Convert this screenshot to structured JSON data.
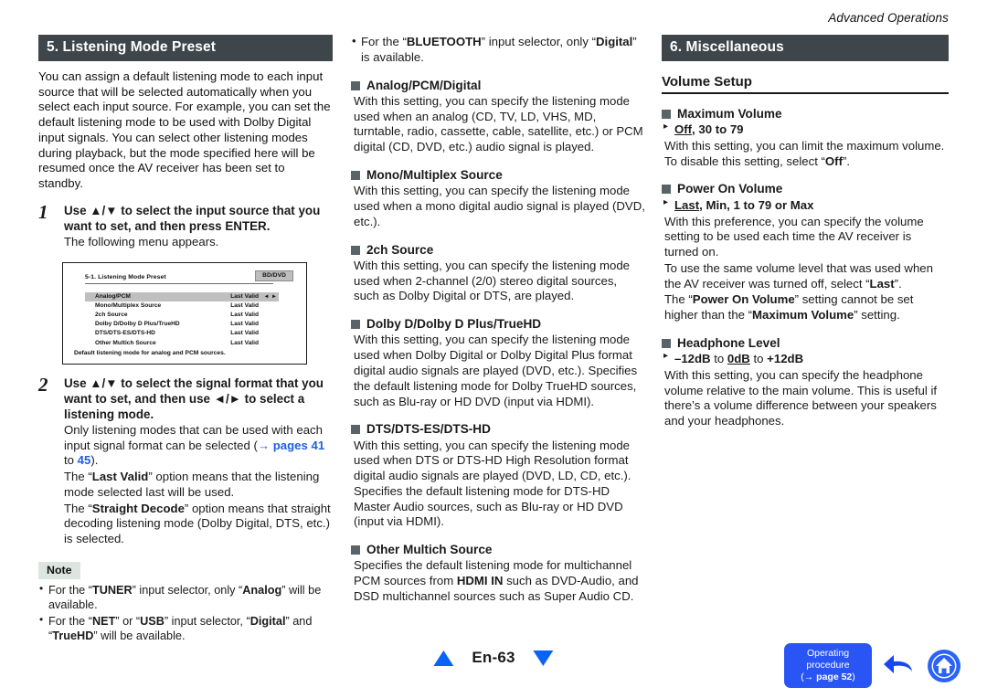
{
  "running_head": "Advanced Operations",
  "col1": {
    "section_title": "5. Listening Mode Preset",
    "intro": "You can assign a default listening mode to each input source that will be selected automatically when you select each input source. For example, you can set the default listening mode to be used with Dolby Digital input signals. You can select other listening modes during playback, but the mode specified here will be resumed once the AV receiver has been set to standby.",
    "step1": {
      "num": "1",
      "head_a": "Use ",
      "head_arrows": "▲/▼",
      "head_b": " to select the input source that you want to set, and then press ENTER.",
      "body": "The following menu appears."
    },
    "osd": {
      "title": "5-1. Listening Mode Preset",
      "badge": "BD/DVD",
      "rows": [
        {
          "label": "Analog/PCM",
          "value": "Last Valid",
          "selected": true,
          "arrows": "◂ ▸"
        },
        {
          "label": "Mono/Multiplex Source",
          "value": "Last Valid",
          "selected": false,
          "arrows": ""
        },
        {
          "label": "2ch Source",
          "value": "Last Valid",
          "selected": false,
          "arrows": ""
        },
        {
          "label": "Dolby D/Dolby D Plus/TrueHD",
          "value": "Last Valid",
          "selected": false,
          "arrows": ""
        },
        {
          "label": "DTS/DTS-ES/DTS-HD",
          "value": "Last Valid",
          "selected": false,
          "arrows": ""
        },
        {
          "label": "Other Multich Source",
          "value": "Last Valid",
          "selected": false,
          "arrows": ""
        }
      ],
      "caption": "Default listening mode for analog and PCM sources."
    },
    "step2": {
      "num": "2",
      "head_a": "Use ",
      "head_arrows_ud": "▲/▼",
      "head_b": " to select the signal format that you want to set, and then use ",
      "head_arrows_lr": "◄/►",
      "head_c": " to select a listening mode.",
      "body1_a": "Only listening modes that can be used with each input signal format can be selected (",
      "body1_arrow": "→",
      "body1_pages": "pages 41",
      "body1_to": " to ",
      "body1_page45": "45",
      "body1_end": ").",
      "body2_a": "The “",
      "body2_b": "Last Valid",
      "body2_c": "” option means that the listening mode selected last will be used.",
      "body3_a": "The “",
      "body3_b": "Straight Decode",
      "body3_c": "” option means that straight decoding listening mode (Dolby Digital, DTS, etc.) is selected."
    },
    "note": {
      "label": "Note",
      "items": [
        {
          "p1": "For the “",
          "b1": "TUNER",
          "p2": "” input selector, only “",
          "b2": "Analog",
          "p3": "” will be available."
        },
        {
          "p1": "For the “",
          "b1": "NET",
          "p2": "” or “",
          "b2": "USB",
          "p3": "” input selector, “",
          "b3": "Digital",
          "p4": "” and “",
          "b4": "TrueHD",
          "p5": "” will be available."
        }
      ]
    }
  },
  "col2": {
    "bullet_top": {
      "p1": "For the “",
      "b1": "BLUETOOTH",
      "p2": "” input selector, only “",
      "b2": "Digital",
      "p3": "” is available."
    },
    "sections": [
      {
        "heading": "Analog/PCM/Digital",
        "body": "With this setting, you can specify the listening mode used when an analog (CD, TV, LD, VHS, MD, turntable, radio, cassette, cable, satellite, etc.) or PCM digital (CD, DVD, etc.) audio signal is played."
      },
      {
        "heading": "Mono/Multiplex Source",
        "body": "With this setting, you can specify the listening mode used when a mono digital audio signal is played (DVD, etc.)."
      },
      {
        "heading": "2ch Source",
        "body": "With this setting, you can specify the listening mode used when 2-channel (2/0) stereo digital sources, such as Dolby Digital or DTS, are played."
      },
      {
        "heading": "Dolby D/Dolby D Plus/TrueHD",
        "body": "With this setting, you can specify the listening mode used when Dolby Digital or Dolby Digital Plus format digital audio signals are played (DVD, etc.). Specifies the default listening mode for Dolby TrueHD sources, such as Blu-ray or HD DVD (input via HDMI)."
      },
      {
        "heading": "DTS/DTS-ES/DTS-HD",
        "body": "With this setting, you can specify the listening mode used when DTS or DTS-HD High Resolution format digital audio signals are played (DVD, LD, CD, etc.). Specifies the default listening mode for DTS-HD Master Audio sources, such as Blu-ray or HD DVD (input via HDMI)."
      }
    ],
    "other_multich": {
      "heading": "Other Multich Source",
      "body_a": "Specifies the default listening mode for multichannel PCM sources from ",
      "body_b": "HDMI IN",
      "body_c": " such as DVD-Audio, and DSD multichannel sources such as Super Audio CD."
    }
  },
  "col3": {
    "section_title": "6. Miscellaneous",
    "group_heading": "Volume Setup",
    "max_volume": {
      "heading": "Maximum Volume",
      "opt_off": "Off",
      "opt_rest": ", 30 to 79",
      "body_a": "With this setting, you can limit the maximum volume. To disable this setting, select “",
      "body_b": "Off",
      "body_c": "”."
    },
    "power_on_volume": {
      "heading": "Power On Volume",
      "opt_last": "Last",
      "opt_rest": ", Min, 1 to 79 or Max",
      "body1": "With this preference, you can specify the volume setting to be used each time the AV receiver is turned on.",
      "body2_a": "To use the same volume level that was used when the AV receiver was turned off, select “",
      "body2_b": "Last",
      "body2_c": "”.",
      "body3_a": "The “",
      "body3_b": "Power On Volume",
      "body3_c": "” setting cannot be set higher than the “",
      "body3_d": "Maximum Volume",
      "body3_e": "” setting."
    },
    "headphone_level": {
      "heading": "Headphone Level",
      "opt_a": "–12dB",
      "opt_to1": " to ",
      "opt_b": "0dB",
      "opt_to2": " to ",
      "opt_c": "+12dB",
      "body": "With this setting, you can specify the headphone volume relative to the main volume. This is useful if there’s a volume difference between your speakers and your headphones."
    }
  },
  "footer": {
    "page_label": "En-63",
    "op_button": {
      "line1": "Operating",
      "line2": "procedure",
      "line3_arrow": "(→ ",
      "line3_page": "page 52",
      "line3_end": ")"
    }
  },
  "colors": {
    "section_bar": "#3e464b",
    "marker_square": "#5a6468",
    "link_blue": "#1f5fe0",
    "nav_blue": "#0a63f5",
    "button_blue": "#2a55f5",
    "note_bg": "#dde5e0"
  }
}
